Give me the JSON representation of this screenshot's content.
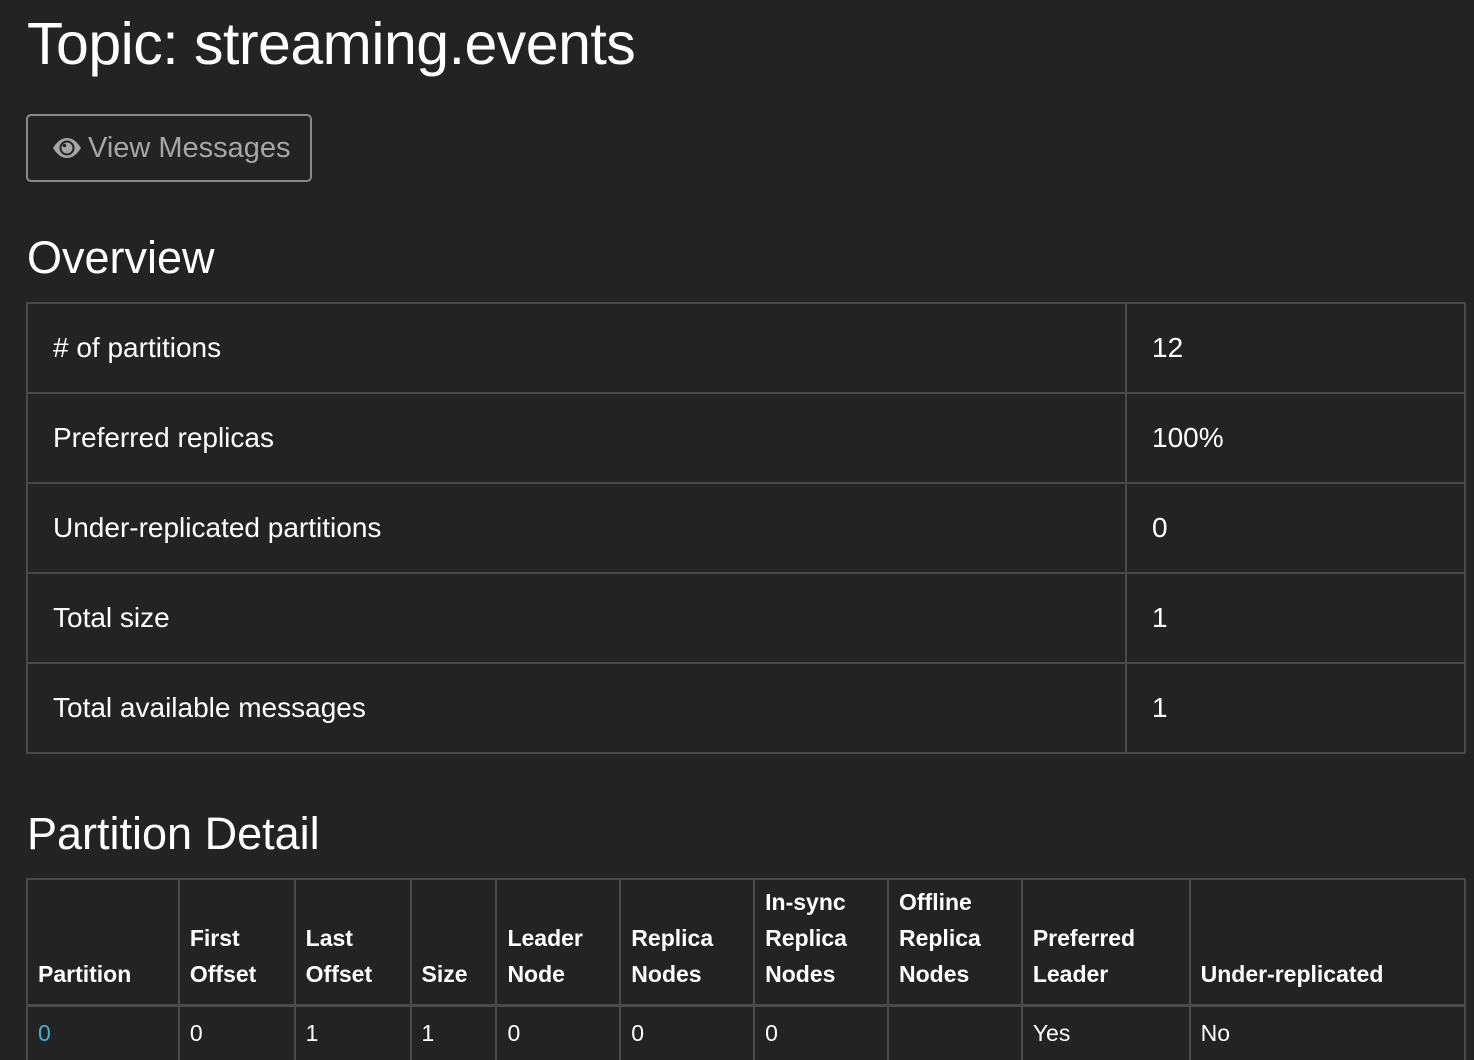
{
  "page": {
    "title": "Topic: streaming.events",
    "view_messages_label": "View Messages"
  },
  "overview": {
    "heading": "Overview",
    "rows": [
      {
        "label": "# of partitions",
        "value": "12"
      },
      {
        "label": "Preferred replicas",
        "value": "100%"
      },
      {
        "label": "Under-replicated partitions",
        "value": "0"
      },
      {
        "label": "Total size",
        "value": "1"
      },
      {
        "label": "Total available messages",
        "value": "1"
      }
    ]
  },
  "partition_detail": {
    "heading": "Partition Detail",
    "columns": [
      [
        "Partition"
      ],
      [
        "First",
        "Offset"
      ],
      [
        "Last",
        "Offset"
      ],
      [
        "Size"
      ],
      [
        "Leader",
        "Node"
      ],
      [
        "Replica",
        "Nodes"
      ],
      [
        "In-sync",
        "Replica",
        "Nodes"
      ],
      [
        "Offline",
        "Replica",
        "Nodes"
      ],
      [
        "Preferred",
        "Leader"
      ],
      [
        "Under-replicated"
      ]
    ],
    "rows": [
      [
        "0",
        "0",
        "1",
        "1",
        "0",
        "0",
        "0",
        "",
        "Yes",
        "No"
      ]
    ]
  },
  "icons": {
    "view_messages": "eye-icon"
  },
  "colors": {
    "background": "#232323",
    "link": "#3bb3d6",
    "border": "#4a4a4a"
  }
}
